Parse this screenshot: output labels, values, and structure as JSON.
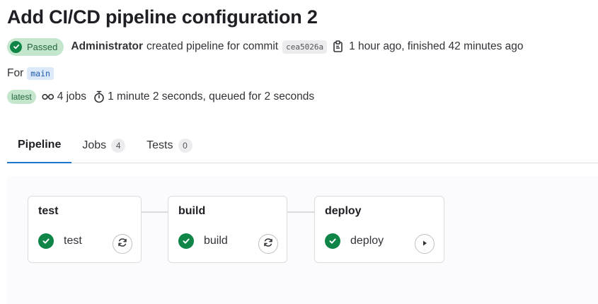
{
  "pipeline": {
    "title": "Add CI/CD pipeline configuration 2",
    "status": "Passed",
    "author": "Administrator",
    "action_text": "created pipeline for commit",
    "commit_sha": "cea5026a",
    "timing": "1 hour ago, finished 42 minutes ago",
    "for_label": "For",
    "ref": "main",
    "latest_badge": "latest",
    "jobs_count": "4 jobs",
    "duration": "1 minute 2 seconds, queued for 2 seconds"
  },
  "tabs": [
    {
      "label": "Pipeline",
      "count": null,
      "active": true
    },
    {
      "label": "Jobs",
      "count": "4",
      "active": false
    },
    {
      "label": "Tests",
      "count": "0",
      "active": false
    }
  ],
  "stages": [
    {
      "name": "test",
      "job": {
        "name": "test",
        "status": "passed",
        "action": "retry-icon"
      }
    },
    {
      "name": "build",
      "job": {
        "name": "build",
        "status": "passed",
        "action": "retry-icon"
      }
    },
    {
      "name": "deploy",
      "job": {
        "name": "deploy",
        "status": "passed",
        "action": "play-icon"
      }
    }
  ],
  "colors": {
    "success": "#108548",
    "success_bg": "#c3e6cd",
    "tab_underline": "#1f75cb",
    "ref_bg": "#dbe9fb"
  }
}
